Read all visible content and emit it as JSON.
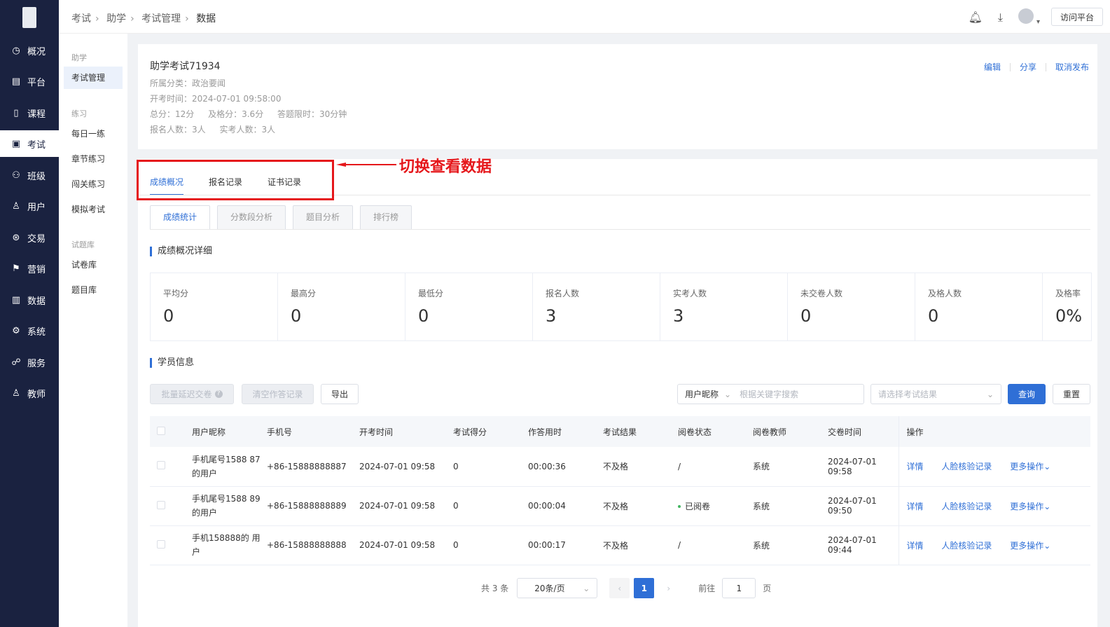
{
  "sidebar": {
    "items": [
      {
        "label": "概况",
        "icon": "clock-icon"
      },
      {
        "label": "平台",
        "icon": "platform-icon"
      },
      {
        "label": "课程",
        "icon": "book-icon"
      },
      {
        "label": "考试",
        "icon": "exam-icon"
      },
      {
        "label": "班级",
        "icon": "class-icon"
      },
      {
        "label": "用户",
        "icon": "user-icon"
      },
      {
        "label": "交易",
        "icon": "trade-icon"
      },
      {
        "label": "营销",
        "icon": "marketing-icon"
      },
      {
        "label": "数据",
        "icon": "chart-icon"
      },
      {
        "label": "系统",
        "icon": "system-icon"
      },
      {
        "label": "服务",
        "icon": "service-icon"
      },
      {
        "label": "教师",
        "icon": "teacher-icon"
      }
    ],
    "active_index": 3
  },
  "subnav": {
    "groups": [
      "助学",
      "练习",
      "试题库"
    ],
    "items": [
      "考试管理",
      "每日一练",
      "章节练习",
      "闯关练习",
      "模拟考试",
      "试卷库",
      "题目库"
    ]
  },
  "breadcrumb": [
    "考试",
    "助学",
    "考试管理",
    "数据"
  ],
  "topbar": {
    "visit_label": "访问平台"
  },
  "exam": {
    "title": "助学考试71934",
    "category": "所属分类：政治要闻",
    "start_time": "开考时间：2024-07-01 09:58:00",
    "total": "总分：12分",
    "pass": "及格分：3.6分",
    "limit": "答题限时：30分钟",
    "enrolled": "报名人数：3人",
    "actual": "实考人数：3人",
    "actions": [
      "编辑",
      "分享",
      "取消发布"
    ]
  },
  "tabs": [
    "成绩概况",
    "报名记录",
    "证书记录"
  ],
  "annotation": "切换查看数据",
  "subtabs": [
    "成绩统计",
    "分数段分析",
    "题目分析",
    "排行榜"
  ],
  "section_overview": "成绩概况详细",
  "section_students": "学员信息",
  "stats": [
    {
      "label": "平均分",
      "value": "0"
    },
    {
      "label": "最高分",
      "value": "0"
    },
    {
      "label": "最低分",
      "value": "0"
    },
    {
      "label": "报名人数",
      "value": "3"
    },
    {
      "label": "实考人数",
      "value": "3"
    },
    {
      "label": "未交卷人数",
      "value": "0"
    },
    {
      "label": "及格人数",
      "value": "0"
    },
    {
      "label": "及格率",
      "value": "0%"
    }
  ],
  "toolbar": {
    "batch_delay": "批量延迟交卷",
    "clear_records": "清空作答记录",
    "export": "导出",
    "nick_select": "用户昵称",
    "keyword_placeholder": "根据关键字搜索",
    "result_placeholder": "请选择考试结果",
    "query": "查询",
    "reset": "重置"
  },
  "table": {
    "headers": [
      "用户昵称",
      "手机号",
      "开考时间",
      "考试得分",
      "作答用时",
      "考试结果",
      "阅卷状态",
      "阅卷教师",
      "交卷时间",
      "操作"
    ],
    "rows": [
      {
        "nick": "手机尾号1588 87的用户",
        "phone": "+86-15888888887",
        "start": "2024-07-01 09:58",
        "score": "0",
        "duration": "00:00:36",
        "result": "不及格",
        "status": "/",
        "teacher": "系统",
        "submit": "2024-07-01 09:58"
      },
      {
        "nick": "手机尾号1588 89的用户",
        "phone": "+86-15888888889",
        "start": "2024-07-01 09:58",
        "score": "0",
        "duration": "00:00:04",
        "result": "不及格",
        "status": "已阅卷",
        "teacher": "系统",
        "submit": "2024-07-01 09:50"
      },
      {
        "nick": "手机158888的 用户",
        "phone": "+86-15888888888",
        "start": "2024-07-01 09:58",
        "score": "0",
        "duration": "00:00:17",
        "result": "不及格",
        "status": "/",
        "teacher": "系统",
        "submit": "2024-07-01 09:44"
      }
    ],
    "actions": [
      "详情",
      "人脸核验记录",
      "更多操作"
    ]
  },
  "pagination": {
    "total": "共 3 条",
    "page_size": "20条/页",
    "current": "1",
    "goto_label": "前往",
    "goto_value": "1",
    "page_suffix": "页"
  },
  "colors": {
    "sidebar_bg": "#1a2240",
    "accent": "#2f6fd6",
    "annotation": "#e5171b"
  }
}
